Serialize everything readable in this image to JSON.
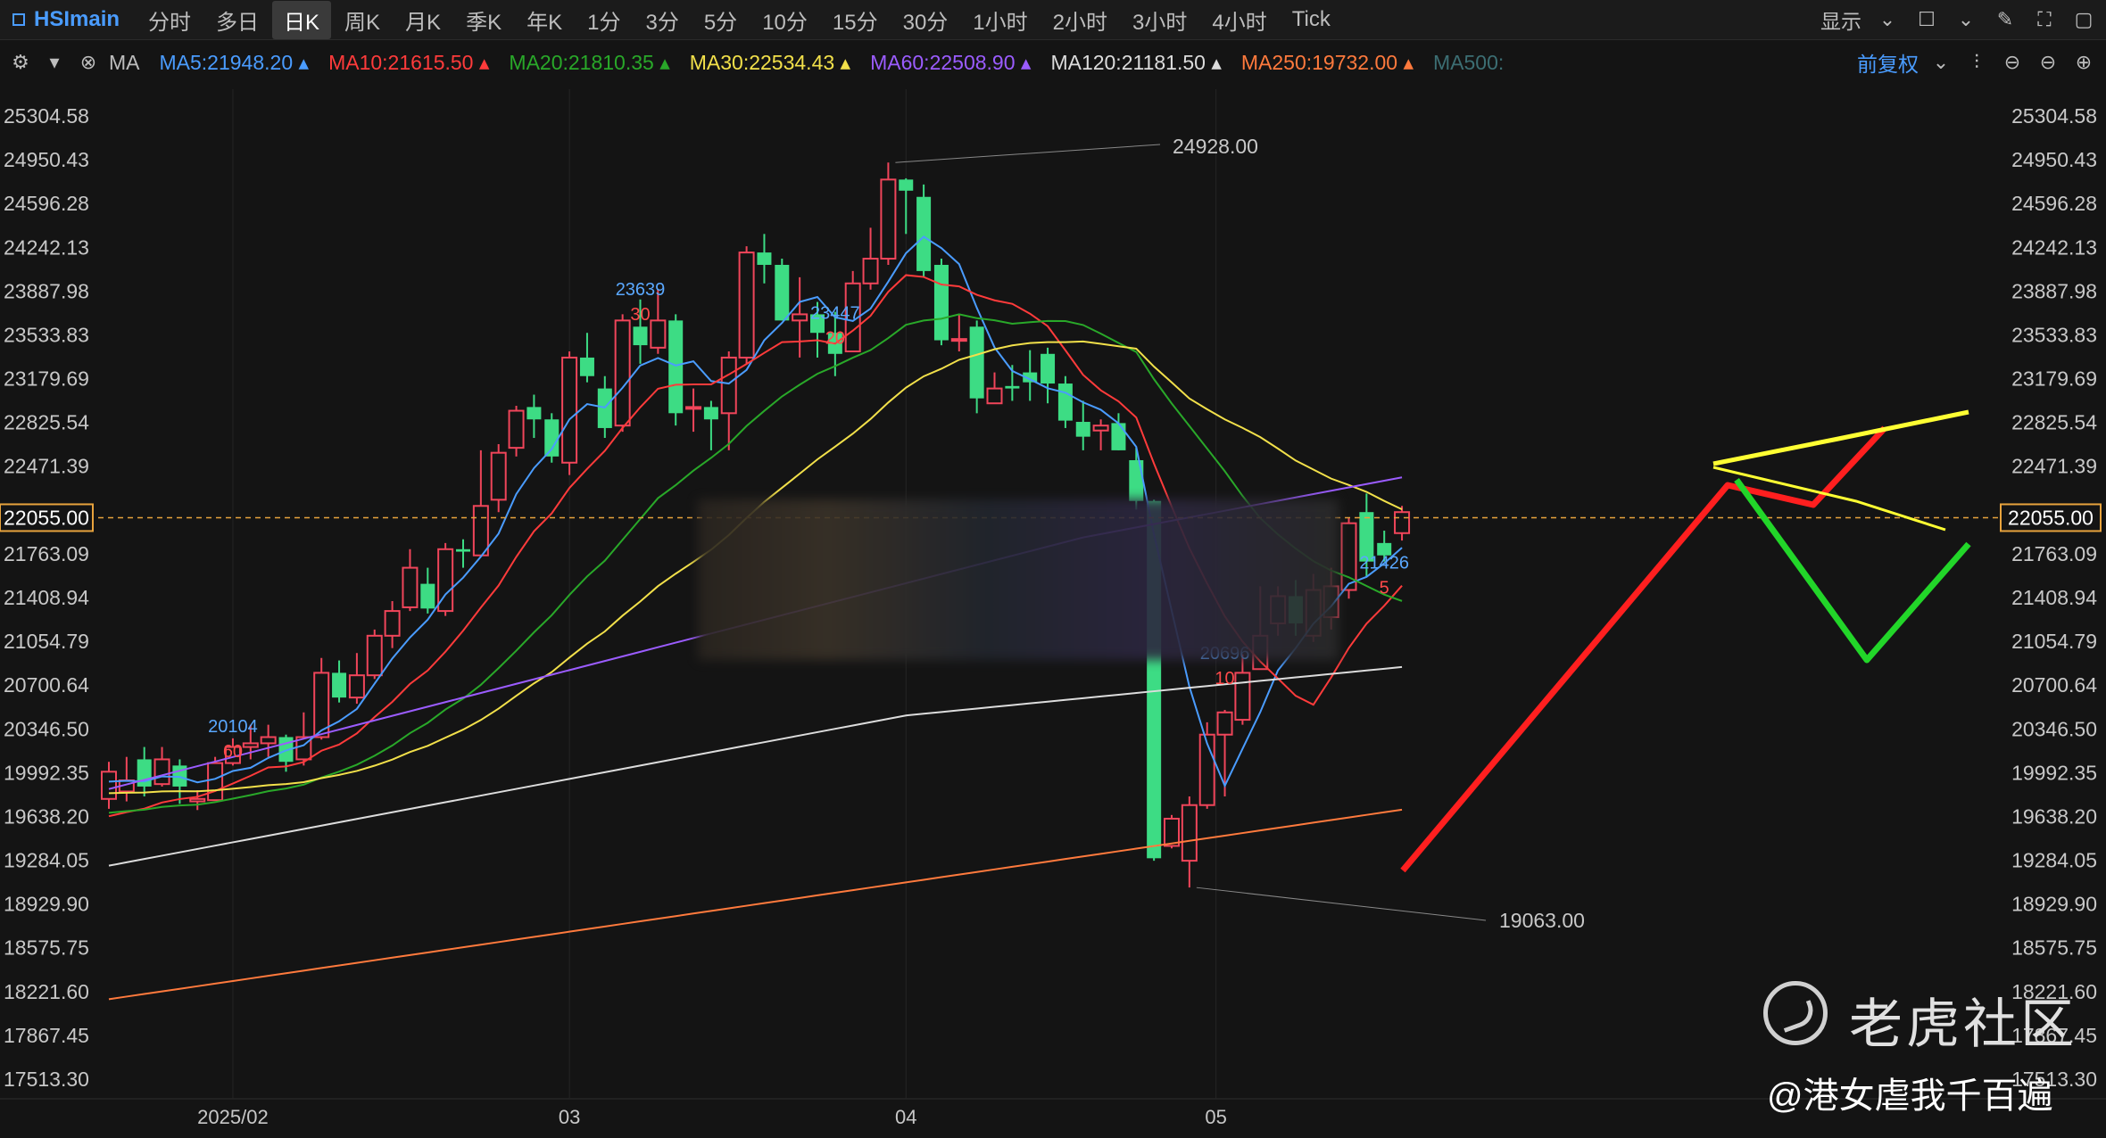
{
  "toolbar": {
    "symbol": "HSImain",
    "periods": [
      "分时",
      "多日",
      "日K",
      "周K",
      "月K",
      "季K",
      "年K",
      "1分",
      "3分",
      "5分",
      "10分",
      "15分",
      "30分",
      "1小时",
      "2小时",
      "3小时",
      "4小时",
      "Tick"
    ],
    "active_period": "日K",
    "display_label": "显示",
    "fq_label": "前复权"
  },
  "ma_bar": {
    "label": "MA",
    "items": [
      {
        "text": "MA5:21948.20",
        "color": "#4a9cff"
      },
      {
        "text": "MA10:21615.50",
        "color": "#ff3b3b"
      },
      {
        "text": "MA20:21810.35",
        "color": "#29a829"
      },
      {
        "text": "MA30:22534.43",
        "color": "#f2e04a"
      },
      {
        "text": "MA60:22508.90",
        "color": "#9b5cff"
      },
      {
        "text": "MA120:21181.50",
        "color": "#dcdcdc"
      },
      {
        "text": "MA250:19732.00",
        "color": "#ff7a3d"
      },
      {
        "text": "MA500:",
        "color": "#3c6e73"
      }
    ]
  },
  "watermark": {
    "brand": "老虎社区",
    "author": "@港女虐我千百遍"
  },
  "chart_data": {
    "type": "candlestick",
    "y_ticks": [
      "25304.58",
      "24950.43",
      "24596.28",
      "24242.13",
      "23887.98",
      "23533.83",
      "23179.69",
      "22825.54",
      "22471.39",
      "21763.09",
      "21408.94",
      "21054.79",
      "20700.64",
      "20346.50",
      "19992.35",
      "19638.20",
      "19284.05",
      "18929.90",
      "18575.75",
      "18221.60",
      "17867.45",
      "17513.30"
    ],
    "y_range": [
      17513.3,
      25304.58
    ],
    "x_labels": [
      {
        "label": "2025/02",
        "index": 7
      },
      {
        "label": "03",
        "index": 26
      },
      {
        "label": "04",
        "index": 45
      },
      {
        "label": "05",
        "index": 62.5
      }
    ],
    "current_price": "22055.00",
    "candles": [
      [
        19780,
        20000,
        20080,
        19700
      ],
      [
        19840,
        19930,
        20120,
        19760
      ],
      [
        20100,
        19880,
        20200,
        19800
      ],
      [
        19900,
        20100,
        20200,
        19880
      ],
      [
        20050,
        19880,
        20100,
        19740
      ],
      [
        19760,
        19780,
        19850,
        19690
      ],
      [
        19770,
        20070,
        20120,
        19770
      ],
      [
        20070,
        20200,
        20270,
        20050
      ],
      [
        20200,
        20230,
        20380,
        20100
      ],
      [
        20230,
        20280,
        20380,
        20120
      ],
      [
        20280,
        20080,
        20300,
        20000
      ],
      [
        20100,
        20280,
        20480,
        20050
      ],
      [
        20280,
        20800,
        20920,
        20260
      ],
      [
        20800,
        20600,
        20900,
        20560
      ],
      [
        20600,
        20780,
        20960,
        20550
      ],
      [
        20780,
        21100,
        21150,
        20750
      ],
      [
        21100,
        21300,
        21380,
        21000
      ],
      [
        21330,
        21650,
        21800,
        21300
      ],
      [
        21520,
        21320,
        21650,
        21280
      ],
      [
        21300,
        21800,
        21850,
        21260
      ],
      [
        21800,
        21780,
        21880,
        21650
      ],
      [
        21750,
        22150,
        22600,
        21750
      ],
      [
        22200,
        22580,
        22650,
        22100
      ],
      [
        22620,
        22920,
        22960,
        22550
      ],
      [
        22950,
        22850,
        23050,
        22700
      ],
      [
        22850,
        22550,
        22900,
        22500
      ],
      [
        22500,
        23350,
        23400,
        22400
      ],
      [
        23350,
        23200,
        23550,
        23150
      ],
      [
        23100,
        22780,
        23200,
        22700
      ],
      [
        22800,
        23650,
        23700,
        22750
      ],
      [
        23600,
        23450,
        23820,
        23300
      ],
      [
        23430,
        23650,
        23900,
        23380
      ],
      [
        23650,
        22900,
        23700,
        22800
      ],
      [
        22950,
        22950,
        23100,
        22750
      ],
      [
        22950,
        22850,
        23000,
        22600
      ],
      [
        22900,
        23350,
        23400,
        22600
      ],
      [
        23350,
        24200,
        24250,
        23300
      ],
      [
        24200,
        24100,
        24350,
        23950
      ],
      [
        24100,
        23650,
        24150,
        23650
      ],
      [
        23650,
        23700,
        24000,
        23350
      ],
      [
        23700,
        23550,
        23800,
        23350
      ],
      [
        23550,
        23380,
        23720,
        23200
      ],
      [
        23400,
        23950,
        24050,
        23400
      ],
      [
        23950,
        24150,
        24400,
        23900
      ],
      [
        24150,
        24790,
        24928,
        24100
      ],
      [
        24790,
        24700,
        24800,
        24350
      ],
      [
        24650,
        24050,
        24750,
        24000
      ],
      [
        24100,
        23490,
        24150,
        23450
      ],
      [
        23500,
        23500,
        23700,
        23400
      ],
      [
        23600,
        23020,
        23650,
        22900
      ],
      [
        22980,
        23100,
        23230,
        22980
      ],
      [
        23120,
        23100,
        23290,
        23000
      ],
      [
        23230,
        23150,
        23410,
        23000
      ],
      [
        23380,
        23140,
        23430,
        22980
      ],
      [
        23140,
        22840,
        23200,
        22780
      ],
      [
        22830,
        22710,
        23000,
        22600
      ],
      [
        22760,
        22800,
        22850,
        22600
      ],
      [
        22820,
        22600,
        22900,
        22600
      ],
      [
        22520,
        22190,
        22620,
        22120
      ],
      [
        22190,
        19300,
        22200,
        19280
      ],
      [
        19400,
        19620,
        19650,
        19380
      ],
      [
        19280,
        19730,
        19800,
        19063
      ],
      [
        19730,
        20300,
        20400,
        19700
      ],
      [
        20300,
        20480,
        20500,
        19800
      ],
      [
        20420,
        20800,
        20950,
        20380
      ],
      [
        20830,
        21100,
        21500,
        20850
      ],
      [
        21200,
        21420,
        21500,
        21100
      ],
      [
        21420,
        21200,
        21550,
        21100
      ],
      [
        21100,
        21470,
        21600,
        21050
      ],
      [
        21250,
        21500,
        21650,
        21150
      ],
      [
        21470,
        22010,
        22050,
        21400
      ],
      [
        22100,
        21700,
        22250,
        21580
      ],
      [
        21850,
        21750,
        21950,
        21700
      ],
      [
        21930,
        22100,
        22150,
        21870
      ]
    ]
  }
}
